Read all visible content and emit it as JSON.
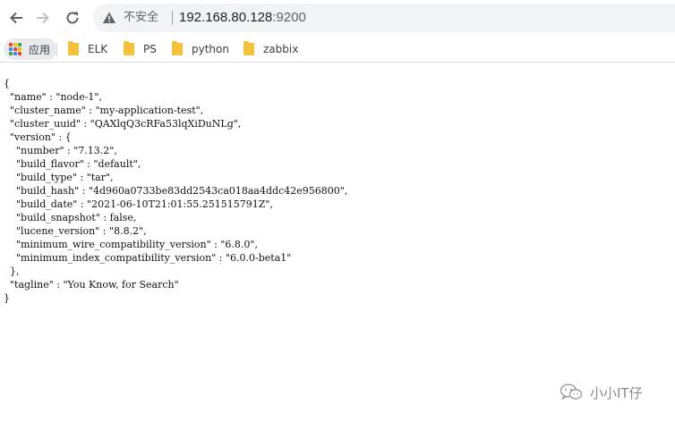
{
  "browser": {
    "security_label": "不安全",
    "url_host": "192.168.80.128",
    "url_port": ":9200"
  },
  "bookmarks": [
    {
      "label": "应用",
      "icon": "apps-grid-icon"
    },
    {
      "label": "ELK",
      "icon": "folder-icon"
    },
    {
      "label": "PS",
      "icon": "folder-icon"
    },
    {
      "label": "python",
      "icon": "folder-icon"
    },
    {
      "label": "zabbix",
      "icon": "folder-icon"
    }
  ],
  "json_lines": [
    "{",
    "  \"name\" : \"node-1\",",
    "  \"cluster_name\" : \"my-application-test\",",
    "  \"cluster_uuid\" : \"QAXlqQ3cRFa53lqXiDuNLg\",",
    "  \"version\" : {",
    "    \"number\" : \"7.13.2\",",
    "    \"build_flavor\" : \"default\",",
    "    \"build_type\" : \"tar\",",
    "    \"build_hash\" : \"4d960a0733be83dd2543ca018aa4ddc42e956800\",",
    "    \"build_date\" : \"2021-06-10T21:01:55.251515791Z\",",
    "    \"build_snapshot\" : false,",
    "    \"lucene_version\" : \"8.8.2\",",
    "    \"minimum_wire_compatibility_version\" : \"6.8.0\",",
    "    \"minimum_index_compatibility_version\" : \"6.0.0-beta1\"",
    "  },",
    "  \"tagline\" : \"You Know, for Search\"",
    "}"
  ],
  "watermark": {
    "text": "小小IT仔",
    "icon": "wechat-icon"
  },
  "colors": {
    "folder": "#f3c13a",
    "omnibox_bg": "#f1f3f4",
    "apps_pill_bg": "#e8eaed"
  }
}
